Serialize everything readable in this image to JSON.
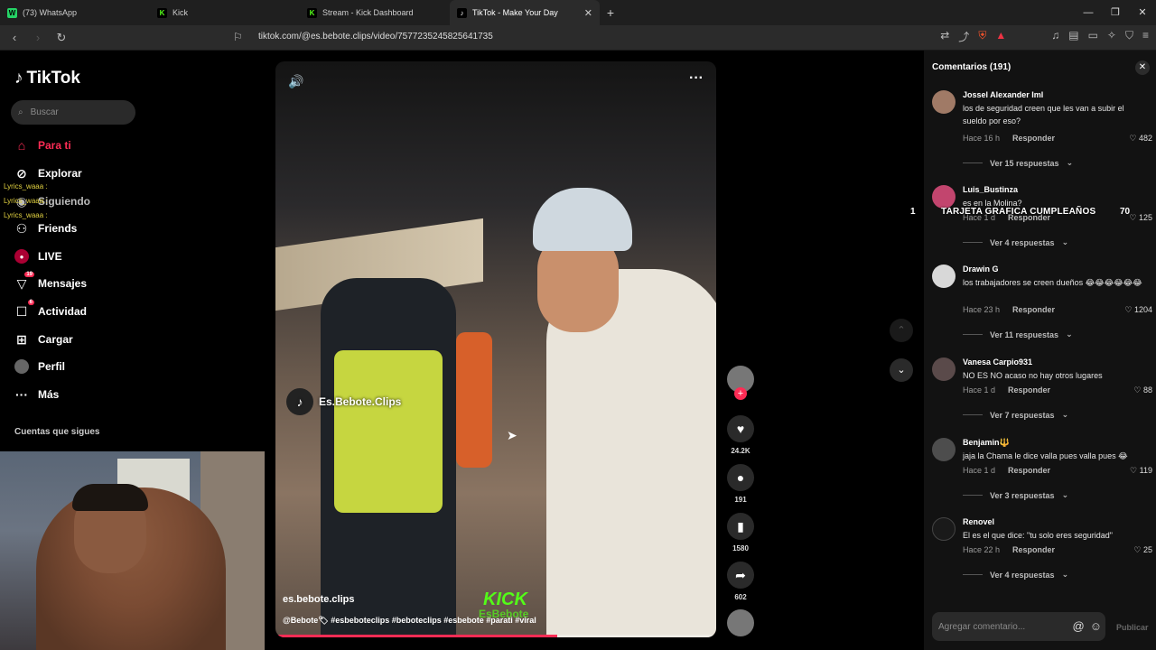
{
  "browser": {
    "tabs": [
      {
        "label": "(73) WhatsApp",
        "fav_color": "#25d366",
        "fav_text": "W"
      },
      {
        "label": "Kick",
        "fav_color": "#53fc18",
        "fav_text": "K"
      },
      {
        "label": "Stream - Kick Dashboard",
        "fav_color": "#53fc18",
        "fav_text": "K"
      },
      {
        "label": "TikTok - Make Your Day",
        "fav_color": "#000000",
        "fav_text": "♪",
        "active": true
      }
    ],
    "url": "tiktok.com/@es.bebote.clips/video/7577235245825641735"
  },
  "sidebar": {
    "logo": "TikTok",
    "search_placeholder": "Buscar",
    "items": [
      {
        "label": "Para ti",
        "icon": "home-icon"
      },
      {
        "label": "Explorar",
        "icon": "compass-icon"
      },
      {
        "label": "Siguiendo",
        "icon": "following-icon"
      },
      {
        "label": "Friends",
        "icon": "friends-icon"
      },
      {
        "label": "LIVE",
        "icon": "live-icon"
      },
      {
        "label": "Mensajes",
        "icon": "messages-icon",
        "badge": "19"
      },
      {
        "label": "Actividad",
        "icon": "activity-icon",
        "badge": "6"
      },
      {
        "label": "Cargar",
        "icon": "upload-icon"
      },
      {
        "label": "Perfil",
        "icon": "profile-icon"
      },
      {
        "label": "Más",
        "icon": "more-icon"
      }
    ],
    "following_label": "Cuentas que sigues",
    "lyrics_overlay": [
      "Lyrics_waaa :",
      "Lyrics_waaa :",
      "Lyrics_waaa :"
    ]
  },
  "video": {
    "watermark": "Es.Bebote.Clips",
    "author": "es.bebote.clips",
    "caption": "@Bebote🏷 #esbeboteclips #beboteclips #esbebote #parati #viral",
    "kick_text": "KICK",
    "kick_sub": "EsBebote",
    "progress": 0.64
  },
  "actions": {
    "likes": "24.2K",
    "comments": "191",
    "saves": "1580",
    "shares": "602"
  },
  "overlay": {
    "banner": "TARJETA GRAFICA CUMPLEAÑOS",
    "banner_num": "70",
    "side_num": "1"
  },
  "comments_panel": {
    "title": "Comentarios (191)",
    "items": [
      {
        "user": "Jossel Alexander Iml",
        "text": "los de seguridad creen que les van a subir el sueldo por eso?",
        "time": "Hace 16 h",
        "reply": "Responder",
        "likes": "482",
        "replies": "Ver 15 respuestas",
        "avatar_color": "#a07a66"
      },
      {
        "user": "Luis_Bustinza",
        "text": "es en la Molina?",
        "time": "Hace 1 d",
        "reply": "Responder",
        "likes": "125",
        "replies": "Ver 4 respuestas",
        "avatar_color": "#c2456e"
      },
      {
        "user": "Drawin G",
        "text": "los trabajadores se creen dueños 😂😂😂😂😂😂",
        "time": "Hace 23 h",
        "reply": "Responder",
        "likes": "1204",
        "replies": "Ver 11 respuestas",
        "avatar_color": "#d8d8d8"
      },
      {
        "user": "Vanesa Carpio931",
        "text": "NO ES NO acaso no hay otros lugares",
        "time": "Hace 1 d",
        "reply": "Responder",
        "likes": "88",
        "replies": "Ver 7 respuestas",
        "avatar_color": "#5a4a4a"
      },
      {
        "user": "Benjamin🔱",
        "text": "jaja la Chama le dice valla pues valla pues 😂",
        "time": "Hace 1 d",
        "reply": "Responder",
        "likes": "119",
        "replies": "Ver 3 respuestas",
        "avatar_color": "#4d4d4d"
      },
      {
        "user": "Renovel",
        "text": "El es el que dice: \"tu solo eres seguridad\"",
        "time": "Hace 22 h",
        "reply": "Responder",
        "likes": "25",
        "replies": "Ver 4 respuestas",
        "avatar_color": "#1a1a1a"
      }
    ],
    "input_placeholder": "Agregar comentario...",
    "post_label": "Publicar"
  }
}
